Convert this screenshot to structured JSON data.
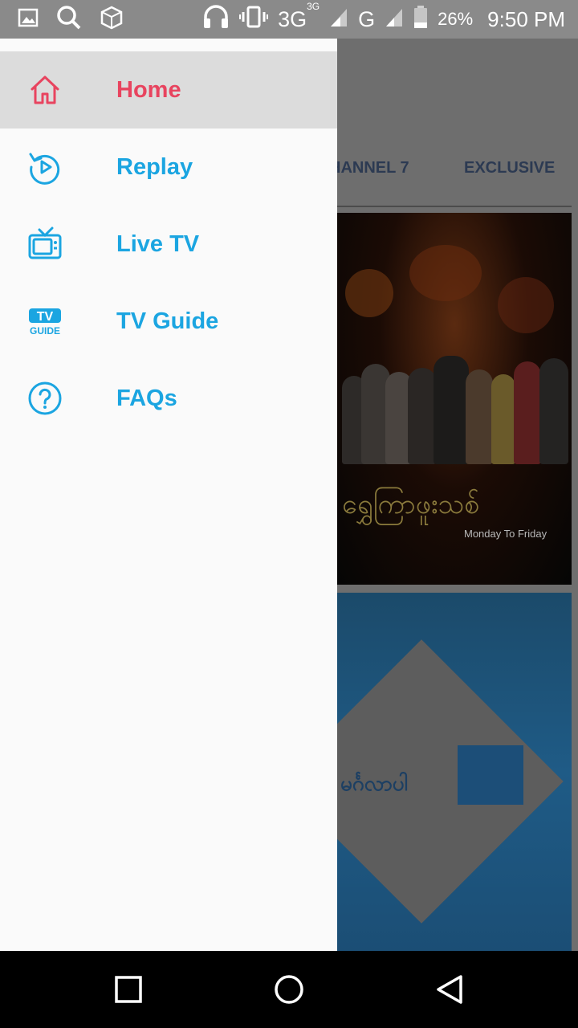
{
  "status_bar": {
    "icons": [
      "gallery-icon",
      "search-icon",
      "cube-icon",
      "headset-icon",
      "vibrate-icon"
    ],
    "network_1": "3G",
    "network_1_sup": "3G",
    "network_2": "G",
    "battery": "26%",
    "time": "9:50 PM"
  },
  "background_app": {
    "tabs": [
      "HANNEL 7",
      "EXCLUSIVE"
    ],
    "poster1": {
      "title": "ရွှေကြာဖူးသစ်",
      "subtitle": "Monday To Friday"
    },
    "poster2": {
      "title": "မင်္ဂလာပါ"
    }
  },
  "drawer": {
    "items": [
      {
        "label": "Home",
        "icon": "home-icon",
        "active": true
      },
      {
        "label": "Replay",
        "icon": "replay-icon",
        "active": false
      },
      {
        "label": "Live TV",
        "icon": "tv-icon",
        "active": false
      },
      {
        "label": "TV Guide",
        "icon": "tv-guide-icon",
        "icon_text_top": "TV",
        "icon_text_bottom": "GUIDE",
        "active": false
      },
      {
        "label": "FAQs",
        "icon": "question-icon",
        "active": false
      }
    ]
  },
  "colors": {
    "accent_active": "#e8445f",
    "accent_blue": "#1ba5e1",
    "active_bg": "#dcdcdc"
  },
  "nav_bar": {
    "buttons": [
      "recents-button",
      "home-button",
      "back-button"
    ]
  }
}
